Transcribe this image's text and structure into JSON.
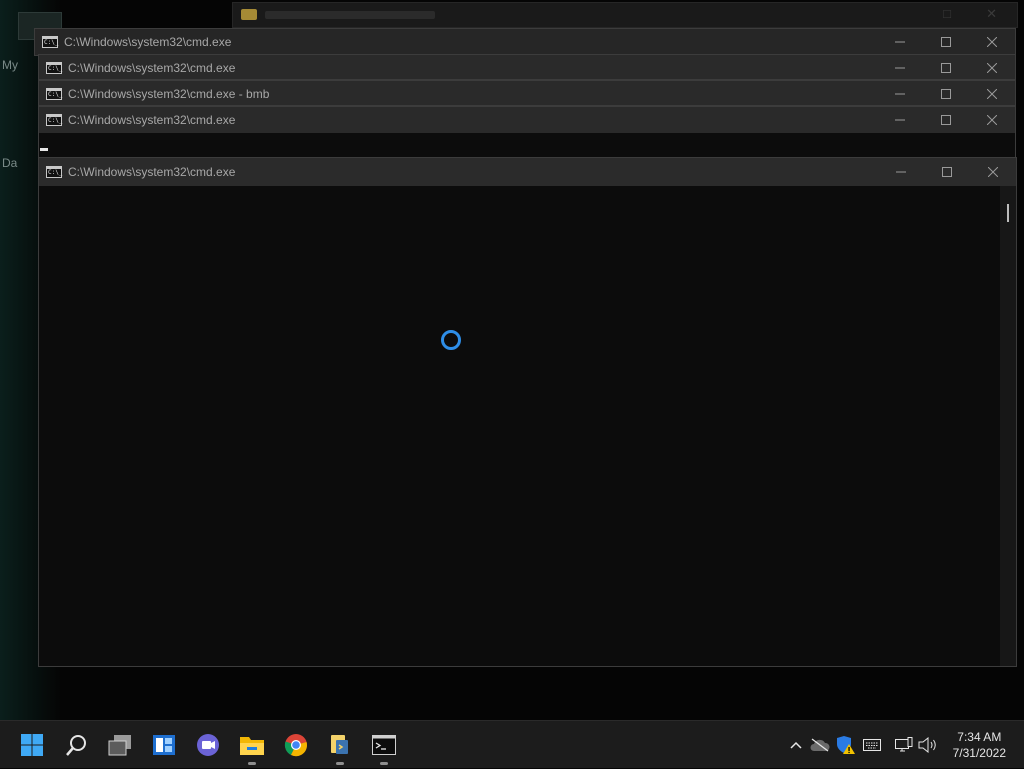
{
  "desktop": {
    "labels": [
      "My",
      "Da"
    ]
  },
  "windows": [
    {
      "title": "C:\\Windows\\system32\\cmd.exe"
    },
    {
      "title": "C:\\Windows\\system32\\cmd.exe"
    },
    {
      "title": "C:\\Windows\\system32\\cmd.exe - bmb"
    },
    {
      "title": "C:\\Windows\\system32\\cmd.exe"
    },
    {
      "title": "C:\\Windows\\system32\\cmd.exe"
    }
  ],
  "window_controls": {
    "minimize_icon": "minimize-icon",
    "maximize_icon": "maximize-icon",
    "close_icon": "close-icon"
  },
  "loading": {
    "icon": "loading-spinner-icon",
    "color": "#2e8ee8"
  },
  "taskbar": {
    "apps": [
      {
        "name": "start",
        "icon": "windows-logo-icon"
      },
      {
        "name": "search",
        "icon": "search-icon"
      },
      {
        "name": "task-view",
        "icon": "task-view-icon"
      },
      {
        "name": "widgets",
        "icon": "widgets-icon"
      },
      {
        "name": "chat",
        "icon": "teams-chat-icon"
      },
      {
        "name": "file-explorer",
        "icon": "folder-icon"
      },
      {
        "name": "chrome",
        "icon": "chrome-icon"
      },
      {
        "name": "python",
        "icon": "python-icon"
      },
      {
        "name": "command-prompt",
        "icon": "terminal-icon"
      }
    ],
    "tray": [
      "chevron-up-icon",
      "cloud-offline-icon",
      "security-warning-icon",
      "keyboard-icon",
      "network-icon",
      "volume-icon"
    ],
    "clock": {
      "time": "7:34 AM",
      "date": "7/31/2022"
    }
  }
}
